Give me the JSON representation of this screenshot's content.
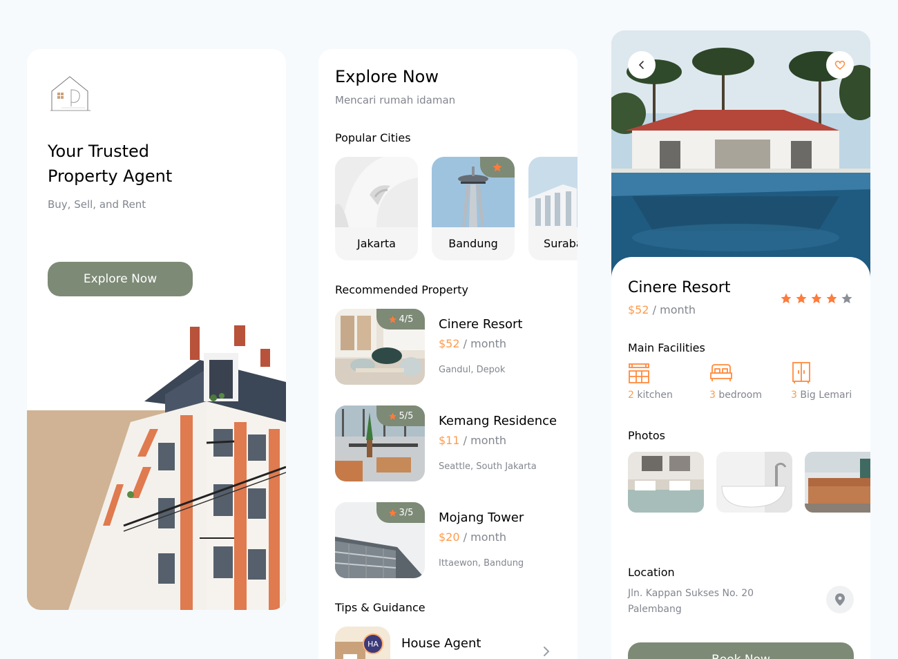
{
  "screen1": {
    "headline": "Your Trusted Property Agent",
    "tagline": "Buy, Sell, and Rent",
    "cta_label": "Explore Now"
  },
  "screen2": {
    "title": "Explore Now",
    "subtitle": "Mencari rumah idaman",
    "popular_label": "Popular Cities",
    "cities": [
      {
        "name": "Jakarta",
        "featured": false
      },
      {
        "name": "Bandung",
        "featured": true
      },
      {
        "name": "Surabaya",
        "featured": false
      }
    ],
    "recommended_label": "Recommended Property",
    "properties": [
      {
        "name": "Cinere Resort",
        "price": "$52",
        "period": "/ month",
        "address": "Gandul, Depok",
        "rating": "4/5"
      },
      {
        "name": "Kemang Residence",
        "price": "$11",
        "period": "/ month",
        "address": "Seattle, South Jakarta",
        "rating": "5/5"
      },
      {
        "name": "Mojang Tower",
        "price": "$20",
        "period": "/ month",
        "address": "Ittaewon, Bandung",
        "rating": "3/5"
      }
    ],
    "tips_label": "Tips & Guidance",
    "tip": {
      "name": "House Agent",
      "badge": "HA"
    }
  },
  "screen3": {
    "title": "Cinere Resort",
    "price": "$52",
    "period": "/ month",
    "rating_stars": 4,
    "rating_max": 5,
    "facilities_label": "Main Facilities",
    "facilities": [
      {
        "count": "2",
        "label": "kitchen",
        "icon": "kitchen-icon"
      },
      {
        "count": "3",
        "label": "bedroom",
        "icon": "bed-icon"
      },
      {
        "count": "3",
        "label": "Big Lemari",
        "icon": "wardrobe-icon"
      }
    ],
    "photos_label": "Photos",
    "location_label": "Location",
    "address_line1": "Jln. Kappan Sukses No. 20",
    "address_line2": "Palembang",
    "book_label": "Book Now"
  },
  "colors": {
    "background": "#F6FAFD",
    "primary": "#7D8A76",
    "accent": "#FF9B4B",
    "muted_text": "#82868E",
    "beige": "#CFB394"
  }
}
